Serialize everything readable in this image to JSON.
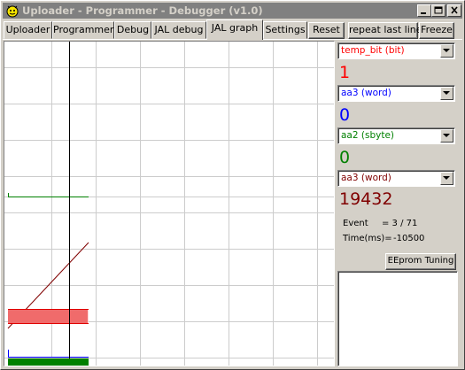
{
  "window": {
    "title": "Uploader - Programmer - Debugger (v1.0)"
  },
  "tabs": [
    {
      "label": "Uploader"
    },
    {
      "label": "Programmer"
    },
    {
      "label": "Debug"
    },
    {
      "label": "JAL debug"
    },
    {
      "label": "JAL graph",
      "active": true
    },
    {
      "label": "Settings"
    }
  ],
  "toolbar": {
    "reset_label": "Reset",
    "repeat_label": "repeat last line",
    "freeze_label": "Freeze"
  },
  "channels": [
    {
      "selected": "temp_bit  (bit)",
      "value": "1",
      "color": "#ff0000"
    },
    {
      "selected": "aa3  (word)",
      "value": "0",
      "color": "#0000ff"
    },
    {
      "selected": "aa2  (sbyte)",
      "value": "0",
      "color": "#008000"
    },
    {
      "selected": "aa3  (word)",
      "value": "19432",
      "color": "#800000"
    }
  ],
  "status": {
    "event_label": "Event",
    "event_value": "=  3 / 71",
    "time_label": "Time(ms)=",
    "time_value": "-10500"
  },
  "eeprom_label": "EEprom Tuning",
  "graph": {
    "grid": true,
    "cursor_color": "#000000",
    "trace_colors": {
      "bit": "#ff0000",
      "word_blue": "#0000ff",
      "sbyte": "#008000",
      "word_red": "#800000"
    }
  },
  "colors": {
    "face": "#d4d0c8",
    "titlebar_inactive": "#808080"
  }
}
